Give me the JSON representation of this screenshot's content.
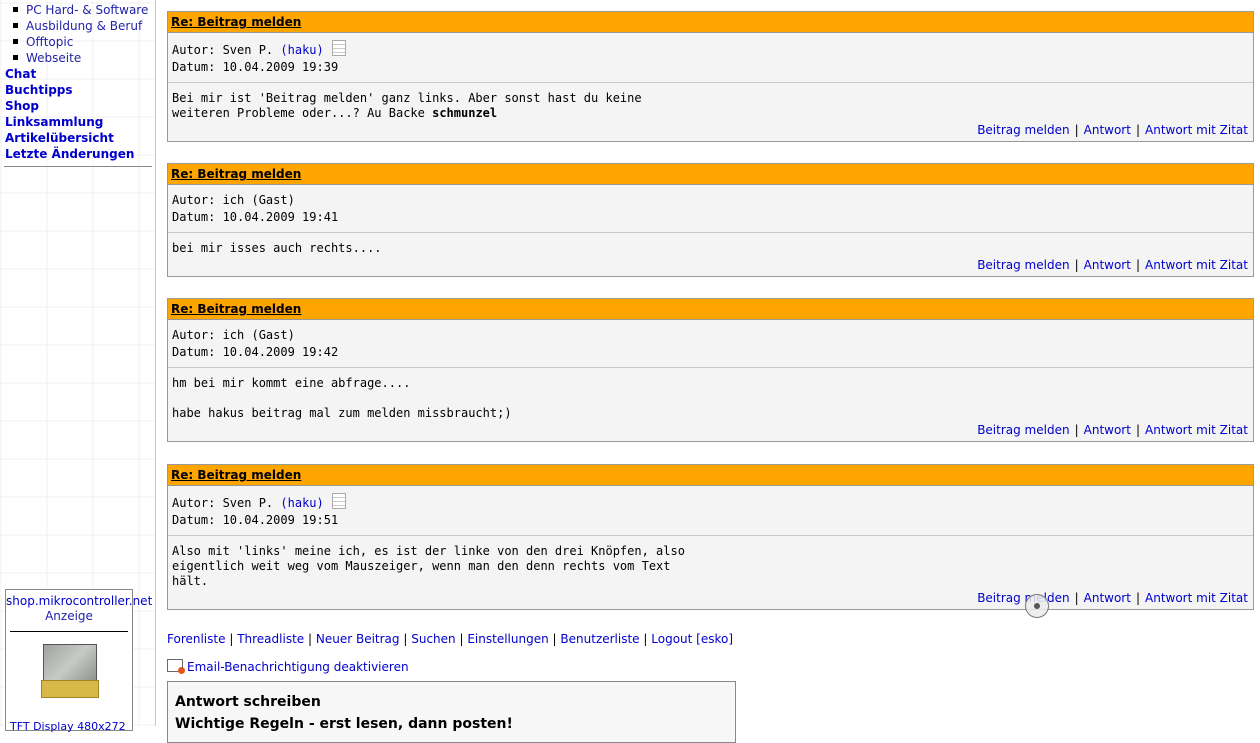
{
  "sidebar": {
    "sub_items": [
      {
        "label": "PC Hard- & Software"
      },
      {
        "label": "Ausbildung & Beruf"
      },
      {
        "label": "Offtopic"
      },
      {
        "label": "Webseite"
      }
    ],
    "main_items": [
      {
        "label": "Chat"
      },
      {
        "label": "Buchtipps"
      },
      {
        "label": "Shop"
      },
      {
        "label": "Linksammlung"
      },
      {
        "label": "Artikelübersicht"
      },
      {
        "label": "Letzte Änderungen"
      }
    ],
    "ad": {
      "title": "shop.mikrocontroller.net",
      "label": "Anzeige",
      "caption": "TFT Display 480x272"
    }
  },
  "posts": [
    {
      "title": "Re: Beitrag melden",
      "author_line": "Autor: Sven P.",
      "author_link": "(haku)",
      "has_doc_icon": true,
      "date_line": "Datum: 10.04.2009 19:39",
      "body_lines": [
        "Bei mir ist 'Beitrag melden' ganz links. Aber sonst hast du keine",
        "weiteren Probleme oder...? Au Backe "
      ],
      "body_bold": "schmunzel"
    },
    {
      "title": "Re: Beitrag melden",
      "author_line": "Autor: ich (Gast)",
      "date_line": "Datum: 10.04.2009 19:41",
      "body_lines": [
        "bei mir isses auch rechts...."
      ]
    },
    {
      "title": "Re: Beitrag melden",
      "author_line": "Autor: ich (Gast)",
      "date_line": "Datum: 10.04.2009 19:42",
      "body_lines": [
        "hm bei mir kommt eine abfrage....",
        "",
        "habe hakus beitrag mal zum melden missbraucht;)"
      ]
    },
    {
      "title": "Re: Beitrag melden",
      "author_line": "Autor: Sven P.",
      "author_link": "(haku)",
      "has_doc_icon": true,
      "date_line": "Datum: 10.04.2009 19:51",
      "body_lines": [
        "Also mit 'links' meine ich, es ist der linke von den drei Knöpfen, also",
        "eigentlich weit weg vom Mauszeiger, wenn man den denn rechts vom Text",
        "hält."
      ]
    }
  ],
  "post_actions": {
    "report": "Beitrag melden",
    "reply": "Antwort",
    "quote": "Antwort mit Zitat",
    "separator": "|"
  },
  "footer": {
    "links": [
      "Forenliste",
      "Threadliste",
      "Neuer Beitrag",
      "Suchen",
      "Einstellungen",
      "Benutzerliste",
      "Logout [esko]"
    ],
    "separator": "|",
    "email": "Email-Benachrichtigung deaktivieren"
  },
  "reply": {
    "title": "Antwort schreiben",
    "rules": "Wichtige Regeln - erst lesen, dann posten!"
  },
  "colors": {
    "post_header": "#ffa500",
    "link": "#0000cc"
  }
}
